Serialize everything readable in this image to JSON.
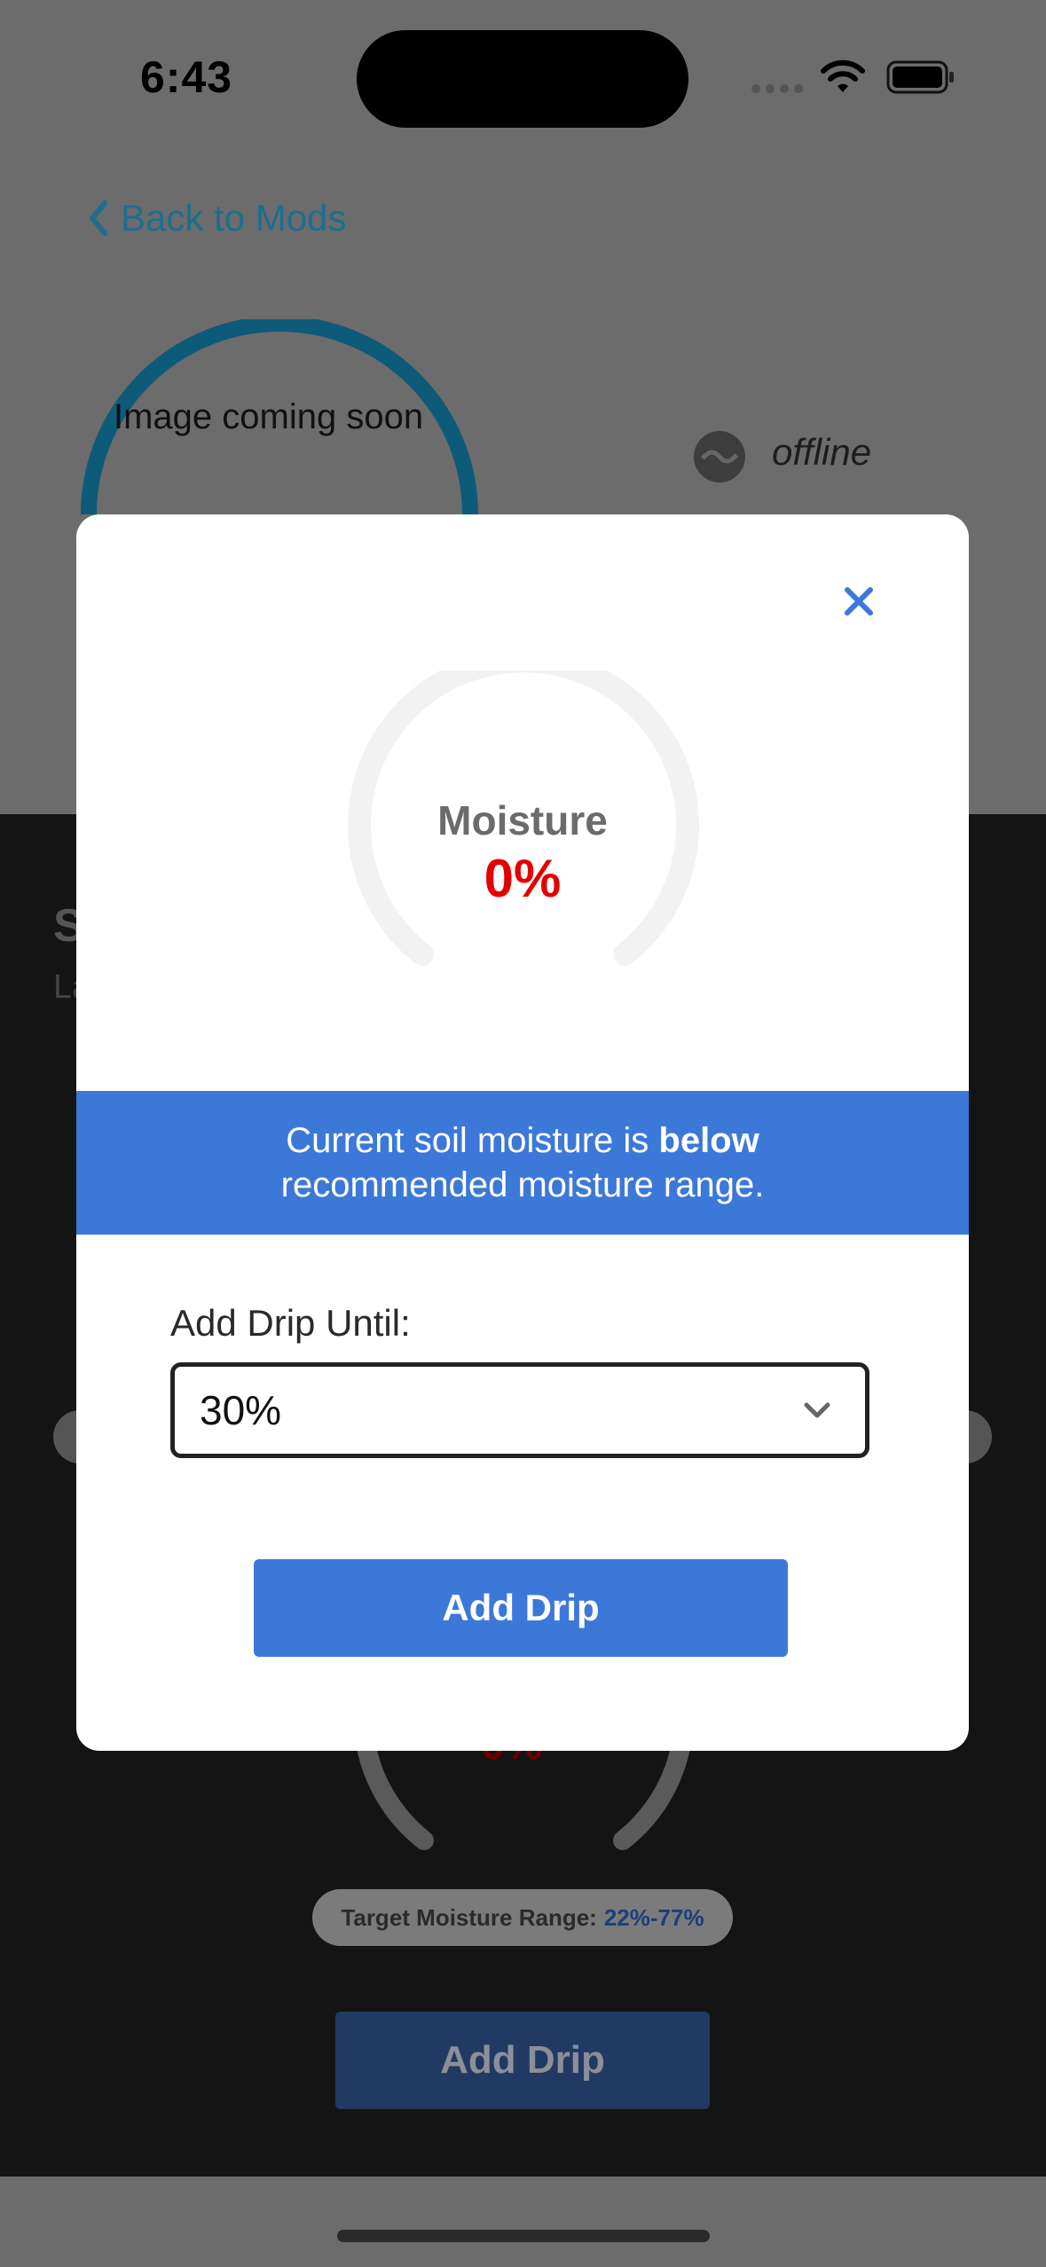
{
  "status_bar": {
    "time": "6:43"
  },
  "header": {
    "back_label": "Back to Mods"
  },
  "device": {
    "image_placeholder": "Image coming soon",
    "connection_status": "offline"
  },
  "background": {
    "title_initial": "S",
    "subtitle_initial": "La",
    "gauge_value": "0%",
    "target_range_label": "Target Moisture Range:",
    "target_range_value": "22%-77%",
    "add_drip_label": "Add Drip"
  },
  "modal": {
    "gauge_title": "Moisture",
    "gauge_value": "0%",
    "moisture_level": 0,
    "banner_prefix": "Current soil moisture is",
    "banner_bold": "below",
    "banner_suffix": "recommended moisture range.",
    "drip_until_label": "Add Drip Until:",
    "drip_until_value": "30%",
    "add_drip_label": "Add Drip"
  },
  "colors": {
    "accent": "#3c78d8",
    "alert": "#e50000",
    "link": "#1d6f8e"
  }
}
